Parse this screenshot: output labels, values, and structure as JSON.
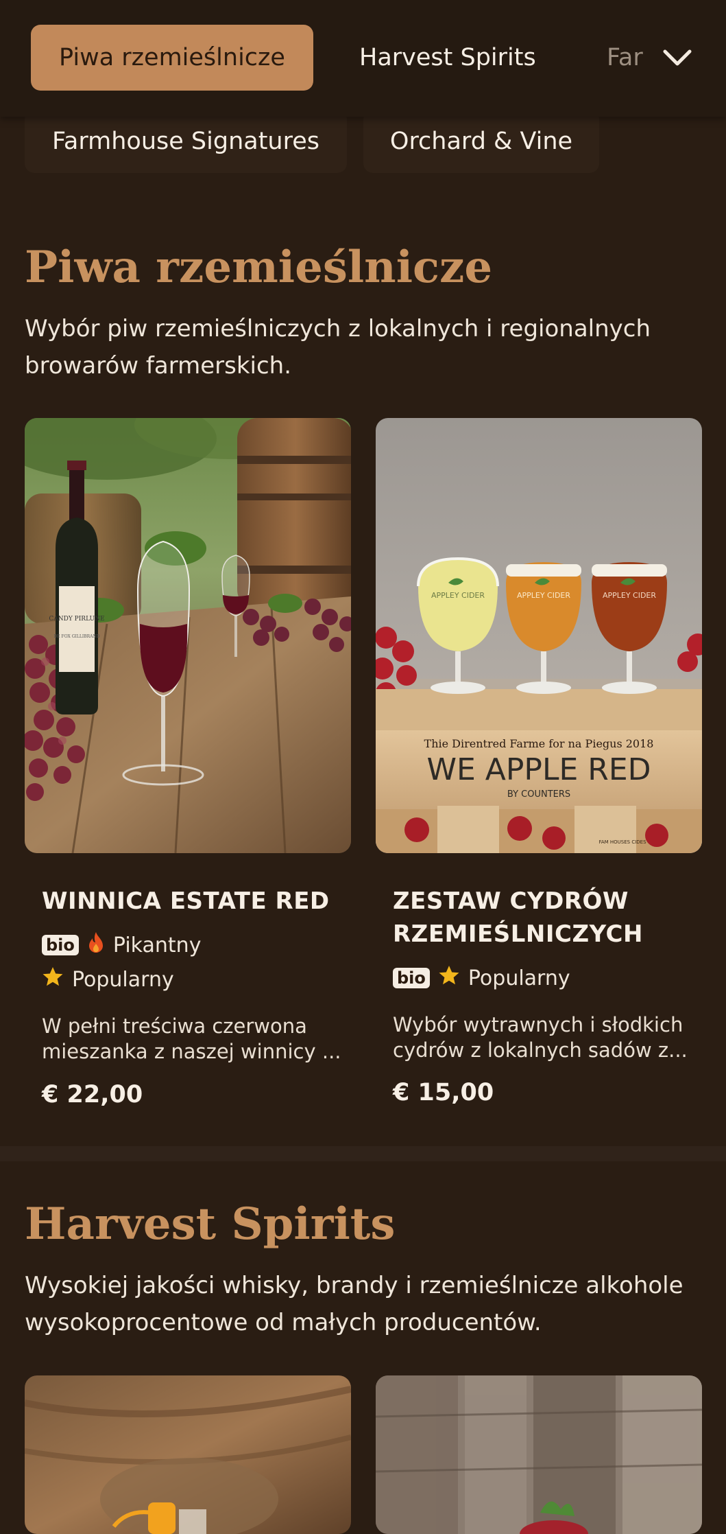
{
  "nav": {
    "tabs": [
      {
        "label": "Piwa rzemieślnicze",
        "active": true
      },
      {
        "label": "Harvest Spirits",
        "active": false
      },
      {
        "label": "Far",
        "active": false
      }
    ],
    "subtabs": [
      {
        "label": "Farmhouse Signatures"
      },
      {
        "label": "Orchard & Vine"
      }
    ],
    "expand_icon": "chevron-down-icon"
  },
  "sections": [
    {
      "title": "Piwa rzemieślnicze",
      "description": "Wybór piw rzemieślniczych z lokalnych i regionalnych browarów farmerskich.",
      "products": [
        {
          "name": "WINNICA ESTATE RED",
          "bio_badge": "bio",
          "spicy_label": "Pikantny",
          "popular_label": "Popularny",
          "description": "W pełni treściwa czerwona mieszanka z naszej winnicy ...",
          "price": "€ 22,00",
          "image_label": "CANDY PIRLUNE",
          "image_subtext": "DE FOX GILLIBRAND"
        },
        {
          "name": "ZESTAW CYDRÓW RZEMIEŚLNICZYCH",
          "bio_badge": "bio",
          "popular_label": "Popularny",
          "description": "Wybór wytrawnych i słodkich cydrów z lokalnych sadów z...",
          "price": "€ 15,00",
          "crate_top": "Thie Direntred Farme for na Piegus 2018",
          "crate_main": "WE APPLE RED",
          "crate_sub": "BY COUNTERS",
          "crate_small": "FAM HOUSES CIDES",
          "glass_label": "APPLEY CIDER"
        }
      ]
    },
    {
      "title": "Harvest Spirits",
      "description": "Wysokiej jakości whisky, brandy i rzemieślnicze alkohole wysokoprocentowe od małych producentów."
    }
  ],
  "colors": {
    "background": "#2a1d13",
    "accent": "#c2895a",
    "title": "#c8925f",
    "star": "#f2b51c",
    "flame": "#e8501f"
  }
}
